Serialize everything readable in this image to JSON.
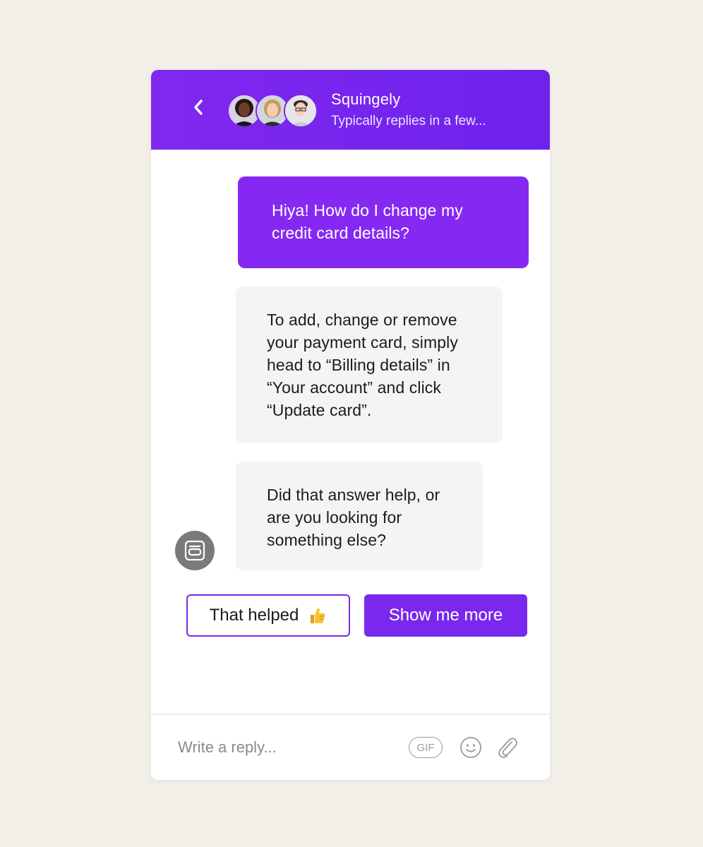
{
  "header": {
    "back_icon": "chevron-left-icon",
    "team_name": "Squingely",
    "reply_time": "Typically replies in a few..."
  },
  "messages": [
    {
      "from": "user",
      "text": "Hiya! How do I change my credit card details?"
    },
    {
      "from": "bot",
      "text": "To add, change or remove your payment card, simply head to “Billing details” in “Your account” and click “Update card”."
    },
    {
      "from": "bot",
      "text": "Did that answer help, or are you looking for something else?"
    }
  ],
  "bot_avatar_icon": "bot-icon",
  "quick_replies": {
    "helped_label": "That helped",
    "helped_icon": "thumbs-up-icon",
    "more_label": "Show me more"
  },
  "composer": {
    "placeholder": "Write a reply...",
    "gif_label": "GIF",
    "emoji_icon": "smiley-icon",
    "attach_icon": "paperclip-icon"
  },
  "colors": {
    "brand": "#7a27ee",
    "user_bubble": "#8529f2",
    "bot_bubble": "#f4f4f4",
    "background": "#f2efe9"
  }
}
